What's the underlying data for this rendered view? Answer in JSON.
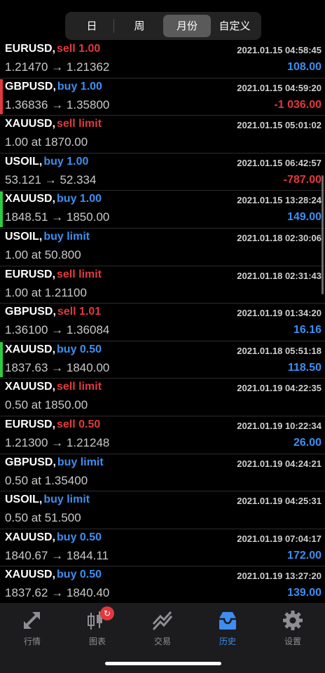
{
  "period_tabs": [
    {
      "label": "日",
      "active": false
    },
    {
      "label": "周",
      "active": false
    },
    {
      "label": "月份",
      "active": true
    },
    {
      "label": "自定义",
      "active": false
    }
  ],
  "colors": {
    "buy": "#3d8ef0",
    "sell": "#e2383e",
    "profit_positive": "#3d8ef0",
    "profit_negative": "#e2383e",
    "marker_red": "#e2383e",
    "marker_green": "#2ecc40"
  },
  "trades": [
    {
      "symbol": "EURUSD,",
      "side": "sell 1.00",
      "side_type": "sell",
      "detail": "1.21470 → 1.21362",
      "time": "2021.01.15 04:58:45",
      "profit": "108.00",
      "profit_sign": "pos",
      "marker": ""
    },
    {
      "symbol": "GBPUSD,",
      "side": "buy 1.00",
      "side_type": "buy",
      "detail": "1.36836 → 1.35800",
      "time": "2021.01.15 04:59:20",
      "profit": "-1 036.00",
      "profit_sign": "neg",
      "marker": "red"
    },
    {
      "symbol": "XAUUSD,",
      "side": "sell limit",
      "side_type": "sell",
      "detail": "1.00 at 1870.00",
      "time": "2021.01.15 05:01:02",
      "profit": "",
      "profit_sign": "",
      "marker": ""
    },
    {
      "symbol": "USOIL,",
      "side": "buy 1.00",
      "side_type": "buy",
      "detail": "53.121 → 52.334",
      "time": "2021.01.15 06:42:57",
      "profit": "-787.00",
      "profit_sign": "neg",
      "marker": ""
    },
    {
      "symbol": "XAUUSD,",
      "side": "buy 1.00",
      "side_type": "buy",
      "detail": "1848.51 → 1850.00",
      "time": "2021.01.15 13:28:24",
      "profit": "149.00",
      "profit_sign": "pos",
      "marker": "green"
    },
    {
      "symbol": "USOIL,",
      "side": "buy limit",
      "side_type": "buy",
      "detail": "1.00 at 50.800",
      "time": "2021.01.18 02:30:06",
      "profit": "",
      "profit_sign": "",
      "marker": ""
    },
    {
      "symbol": "EURUSD,",
      "side": "sell limit",
      "side_type": "sell",
      "detail": "1.00 at 1.21100",
      "time": "2021.01.18 02:31:43",
      "profit": "",
      "profit_sign": "",
      "marker": ""
    },
    {
      "symbol": "GBPUSD,",
      "side": "sell 1.01",
      "side_type": "sell",
      "detail": "1.36100 → 1.36084",
      "time": "2021.01.19 01:34:20",
      "profit": "16.16",
      "profit_sign": "pos",
      "marker": ""
    },
    {
      "symbol": "XAUUSD,",
      "side": "buy 0.50",
      "side_type": "buy",
      "detail": "1837.63 → 1840.00",
      "time": "2021.01.18 05:51:18",
      "profit": "118.50",
      "profit_sign": "pos",
      "marker": "green"
    },
    {
      "symbol": "XAUUSD,",
      "side": "sell limit",
      "side_type": "sell",
      "detail": "0.50 at 1850.00",
      "time": "2021.01.19 04:22:35",
      "profit": "",
      "profit_sign": "",
      "marker": ""
    },
    {
      "symbol": "EURUSD,",
      "side": "sell 0.50",
      "side_type": "sell",
      "detail": "1.21300 → 1.21248",
      "time": "2021.01.19 10:22:34",
      "profit": "26.00",
      "profit_sign": "pos",
      "marker": ""
    },
    {
      "symbol": "GBPUSD,",
      "side": "buy limit",
      "side_type": "buy",
      "detail": "0.50 at 1.35400",
      "time": "2021.01.19 04:24:21",
      "profit": "",
      "profit_sign": "",
      "marker": ""
    },
    {
      "symbol": "USOIL,",
      "side": "buy limit",
      "side_type": "buy",
      "detail": "0.50 at 51.500",
      "time": "2021.01.19 04:25:31",
      "profit": "",
      "profit_sign": "",
      "marker": ""
    },
    {
      "symbol": "XAUUSD,",
      "side": "buy 0.50",
      "side_type": "buy",
      "detail": "1840.67 → 1844.11",
      "time": "2021.01.19 07:04:17",
      "profit": "172.00",
      "profit_sign": "pos",
      "marker": ""
    },
    {
      "symbol": "XAUUSD,",
      "side": "buy 0.50",
      "side_type": "buy",
      "detail": "1837.62 → 1840.40",
      "time": "2021.01.19 13:27:20",
      "profit": "139.00",
      "profit_sign": "pos",
      "marker": ""
    }
  ],
  "bottom_nav": [
    {
      "label": "行情",
      "icon": "quotes-arrows-icon",
      "active": false
    },
    {
      "label": "图表",
      "icon": "candlestick-chart-icon",
      "active": false,
      "badge_icon": "refresh-icon"
    },
    {
      "label": "交易",
      "icon": "trade-trend-icon",
      "active": false
    },
    {
      "label": "历史",
      "icon": "history-inbox-icon",
      "active": true
    },
    {
      "label": "设置",
      "icon": "gear-icon",
      "active": false
    }
  ]
}
